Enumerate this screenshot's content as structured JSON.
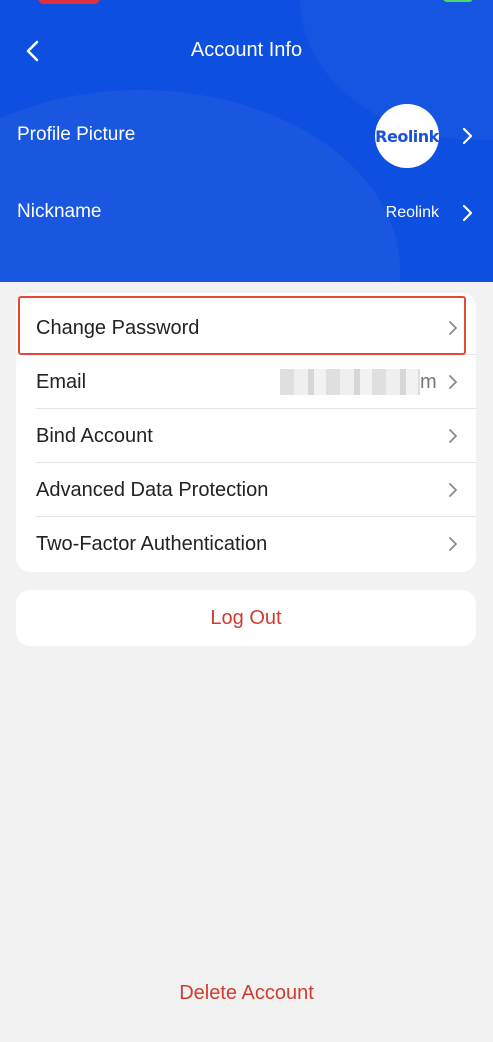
{
  "header": {
    "title": "Account Info",
    "profile_picture_label": "Profile Picture",
    "avatar_text": "Reolink",
    "nickname_label": "Nickname",
    "nickname_value": "Reolink"
  },
  "account_list": {
    "items": [
      {
        "label": "Change Password"
      },
      {
        "label": "Email",
        "value_tail": "m"
      },
      {
        "label": "Bind Account"
      },
      {
        "label": "Advanced Data Protection"
      },
      {
        "label": "Two-Factor Authentication"
      }
    ]
  },
  "actions": {
    "logout_label": "Log Out",
    "delete_label": "Delete Account"
  },
  "colors": {
    "header_blue": "#0d4fe0",
    "danger_red": "#d23b2e",
    "highlight_red": "#e24a3a",
    "background": "#f2f2f2"
  }
}
